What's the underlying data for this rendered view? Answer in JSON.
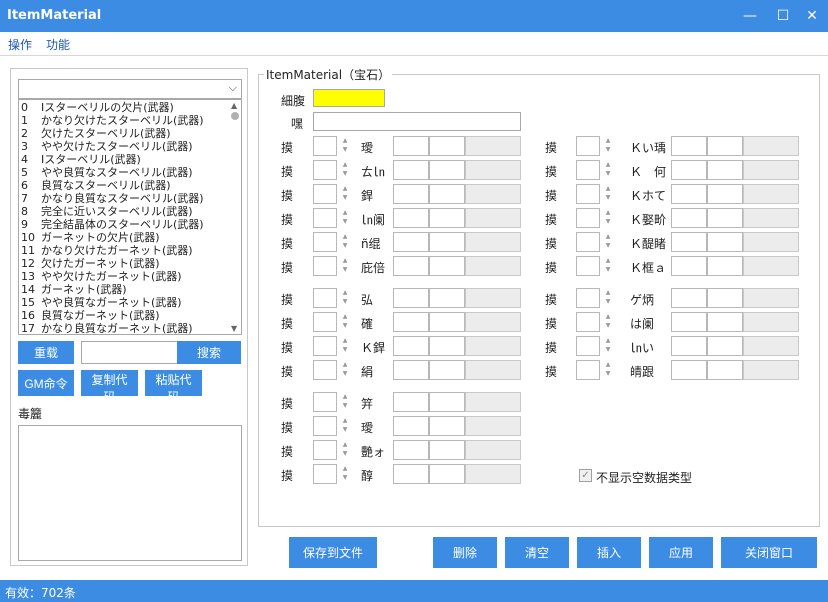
{
  "window": {
    "title": "ItemMaterial",
    "minimize": "—",
    "maximize": "☐",
    "close": "✕"
  },
  "menu": [
    "操作",
    "功能"
  ],
  "left": {
    "combo_value": "",
    "items": [
      {
        "idx": "0",
        "text": "Iスターベリルの欠片(武器)"
      },
      {
        "idx": "1",
        "text": "かなり欠けたスターベリル(武器)"
      },
      {
        "idx": "2",
        "text": "欠けたスターベリル(武器)"
      },
      {
        "idx": "3",
        "text": "やや欠けたスターベリル(武器)"
      },
      {
        "idx": "4",
        "text": "Iスターベリル(武器)"
      },
      {
        "idx": "5",
        "text": "やや良質なスターベリル(武器)"
      },
      {
        "idx": "6",
        "text": "良質なスターベリル(武器)"
      },
      {
        "idx": "7",
        "text": "かなり良質なスターベリル(武器)"
      },
      {
        "idx": "8",
        "text": "完全に近いスターベリル(武器)"
      },
      {
        "idx": "9",
        "text": "完全結晶体のスターベリル(武器)"
      },
      {
        "idx": "10",
        "text": "ガーネットの欠片(武器)"
      },
      {
        "idx": "11",
        "text": "かなり欠けたガーネット(武器)"
      },
      {
        "idx": "12",
        "text": "欠けたガーネット(武器)"
      },
      {
        "idx": "13",
        "text": "やや欠けたガーネット(武器)"
      },
      {
        "idx": "14",
        "text": "ガーネット(武器)"
      },
      {
        "idx": "15",
        "text": "やや良質なガーネット(武器)"
      },
      {
        "idx": "16",
        "text": "良質なガーネット(武器)"
      },
      {
        "idx": "17",
        "text": "かなり良質なガーネット(武器)"
      }
    ],
    "reload": "重载",
    "search_value": "",
    "search": "搜索",
    "gm": "GM命令",
    "copy": "复制代码",
    "paste": "粘贴代码",
    "notes_label": "毒籭"
  },
  "group": {
    "title": "ItemMaterial（宝石）",
    "color_label": "細腹",
    "name_label": "嘿",
    "left_rows": [
      {
        "label": "摸",
        "stat": "璦"
      },
      {
        "label": "摸",
        "stat": "ㄊ㏑"
      },
      {
        "label": "摸",
        "stat": "銲"
      },
      {
        "label": "摸",
        "stat": "㏑阑"
      },
      {
        "label": "摸",
        "stat": "ñ绲"
      },
      {
        "label": "摸",
        "stat": "庇倍"
      },
      {
        "label": "摸",
        "stat": "弘"
      },
      {
        "label": "摸",
        "stat": "確"
      },
      {
        "label": "摸",
        "stat": "Ｋ銲"
      },
      {
        "label": "摸",
        "stat": "絹"
      },
      {
        "label": "摸",
        "stat": "笄"
      },
      {
        "label": "摸",
        "stat": "璦"
      },
      {
        "label": "摸",
        "stat": "艷ォ"
      },
      {
        "label": "摸",
        "stat": "醇"
      }
    ],
    "right_rows": [
      {
        "label": "摸",
        "stat": "Ｋい瑀"
      },
      {
        "label": "摸",
        "stat": "Ｋ　何"
      },
      {
        "label": "摸",
        "stat": "Ｋホて"
      },
      {
        "label": "摸",
        "stat": "Ｋ娶畍"
      },
      {
        "label": "摸",
        "stat": "Ｋ醍睹"
      },
      {
        "label": "摸",
        "stat": "Ｋ框ａ"
      },
      {
        "label": "摸",
        "stat": "ゲ炳"
      },
      {
        "label": "摸",
        "stat": "は阑"
      },
      {
        "label": "摸",
        "stat": "㏑い"
      },
      {
        "label": "摸",
        "stat": "皘跟"
      }
    ],
    "hide_empty": "不显示空数据类型",
    "swatch_color": "#ffff00"
  },
  "actions": {
    "save": "保存到文件",
    "delete": "删除",
    "clear": "清空",
    "insert": "插入",
    "apply": "应用",
    "close": "关闭窗口"
  },
  "status": "有效：702条"
}
